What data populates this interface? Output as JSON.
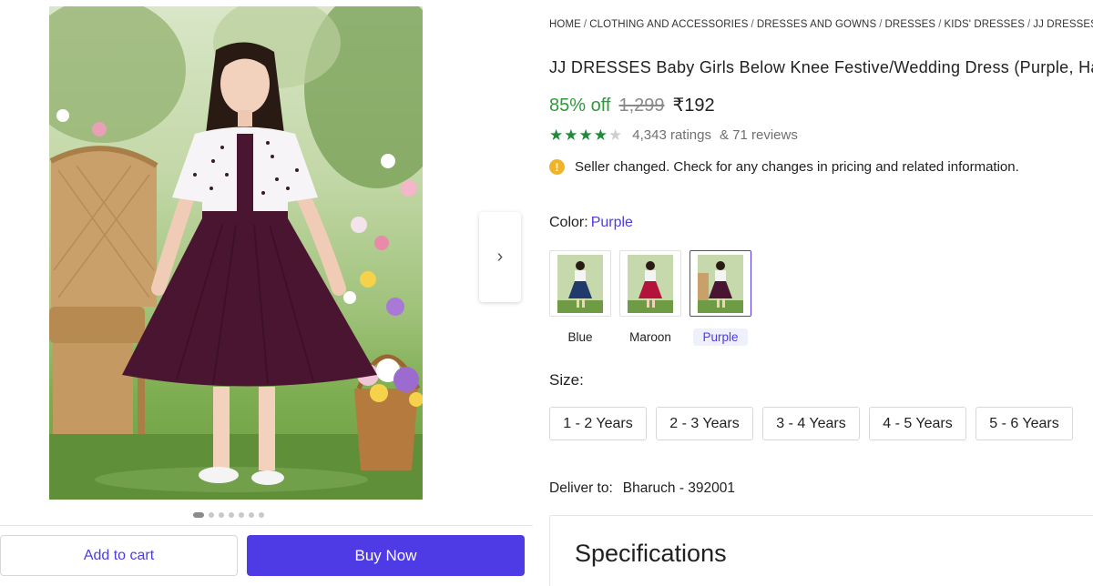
{
  "gallery": {
    "next_icon": "chevron-right-icon",
    "dots_count": 7,
    "active_dot": 0
  },
  "actions": {
    "add_to_cart": "Add to cart",
    "buy_now": "Buy Now"
  },
  "breadcrumb": [
    "HOME",
    "CLOTHING AND ACCESSORIES",
    "DRESSES AND GOWNS",
    "DRESSES",
    "KIDS' DRESSES",
    "JJ DRESSES KIDS"
  ],
  "product": {
    "title": "JJ DRESSES Baby Girls Below Knee Festive/Wedding Dress (Purple, Ha",
    "discount": "85% off",
    "mrp": "1,299",
    "price": "₹192",
    "rating_stars": 4,
    "ratings": "4,343 ratings",
    "reviews": "& 71 reviews",
    "notice": "Seller changed. Check for any changes in pricing and related information."
  },
  "color": {
    "label": "Color:",
    "selected": "Purple",
    "options": [
      {
        "label": "Blue",
        "skirt": "#1f3a6b"
      },
      {
        "label": "Maroon",
        "skirt": "#b3123a"
      },
      {
        "label": "Purple",
        "skirt": "#4a1530"
      }
    ]
  },
  "size": {
    "label": "Size:",
    "options": [
      "1 - 2 Years",
      "2 - 3 Years",
      "3 - 4 Years",
      "4 - 5 Years",
      "5 - 6 Years"
    ]
  },
  "delivery": {
    "label": "Deliver to:",
    "location": "Bharuch - 392001"
  },
  "specs": {
    "title": "Specifications"
  },
  "colors": {
    "accent": "#4f3be6",
    "discount_green": "#2e9a3a",
    "star_green": "#1f8a3a",
    "info_yellow": "#f0b429",
    "dress_purple": "#4a1530"
  }
}
